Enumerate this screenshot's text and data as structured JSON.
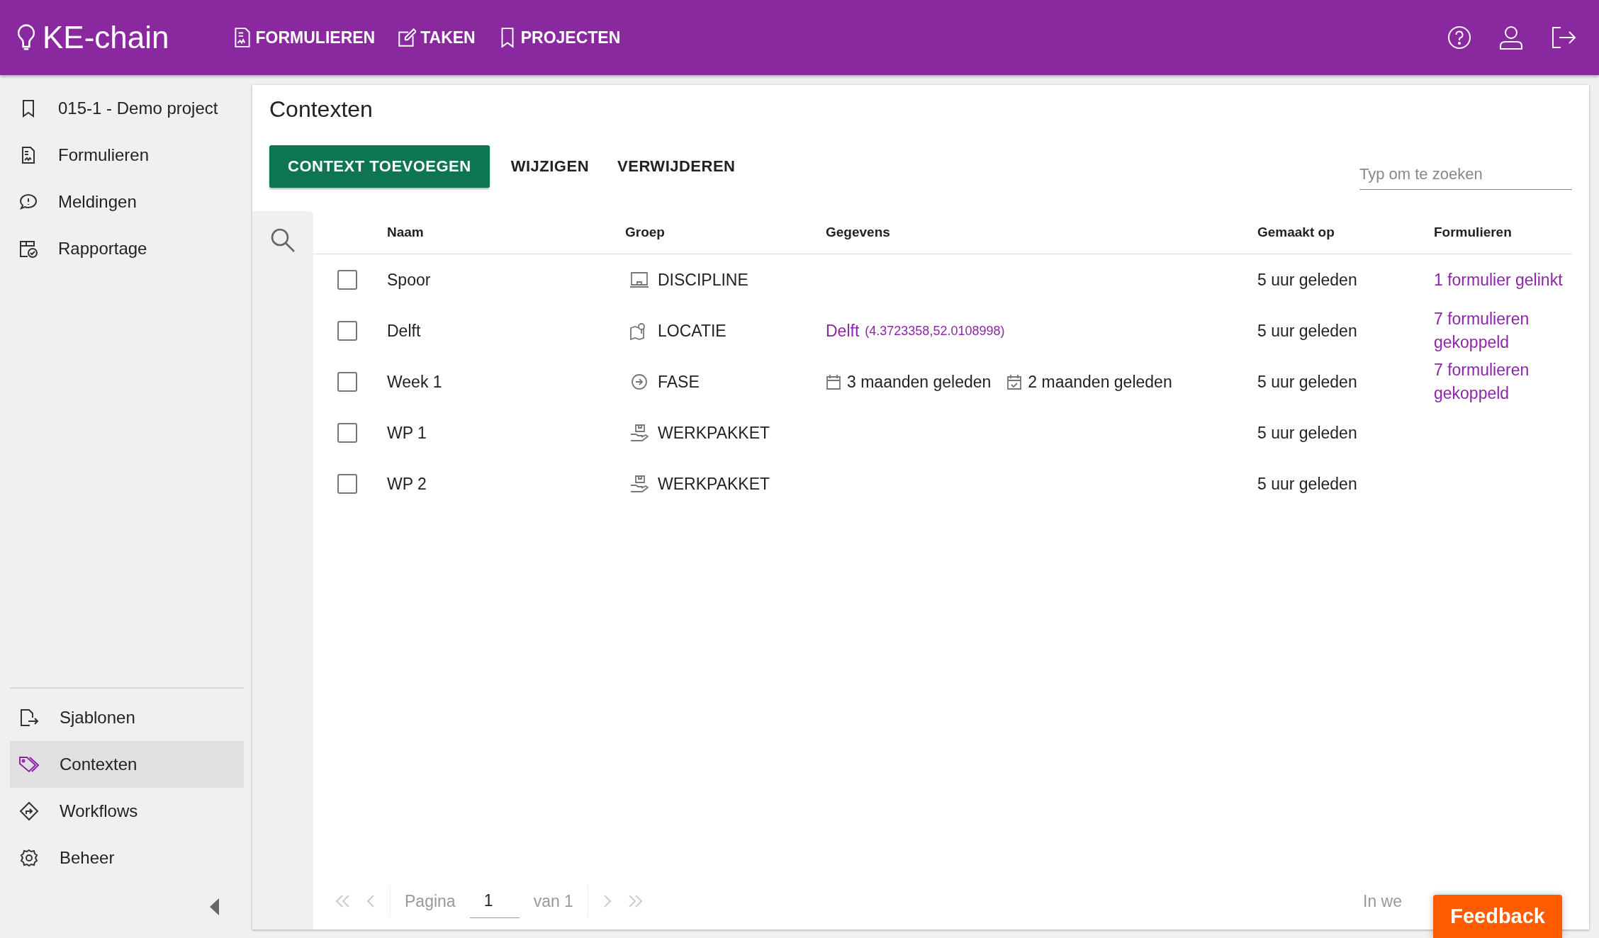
{
  "app": {
    "logo": "KE-chain"
  },
  "top_nav": [
    {
      "label": "FORMULIEREN"
    },
    {
      "label": "TAKEN"
    },
    {
      "label": "PROJECTEN"
    }
  ],
  "sidebar": {
    "top_items": [
      {
        "label": "015-1 - Demo project",
        "selected": false
      },
      {
        "label": "Formulieren",
        "selected": false
      },
      {
        "label": "Meldingen",
        "selected": false
      },
      {
        "label": "Rapportage",
        "selected": false
      }
    ],
    "bottom_items": [
      {
        "label": "Sjablonen",
        "selected": false
      },
      {
        "label": "Contexten",
        "selected": true
      },
      {
        "label": "Workflows",
        "selected": false
      },
      {
        "label": "Beheer",
        "selected": false
      }
    ]
  },
  "page": {
    "title": "Contexten",
    "actions": [
      {
        "label": "CONTEXT TOEVOEGEN",
        "kind": "primary"
      },
      {
        "label": "WIJZIGEN",
        "kind": "text"
      },
      {
        "label": "VERWIJDEREN",
        "kind": "text"
      }
    ],
    "search": {
      "placeholder": "Typ om te zoeken"
    }
  },
  "table": {
    "columns": [
      "Naam",
      "Groep",
      "Gegevens",
      "Gemaakt op",
      "Formulieren"
    ],
    "rows": [
      {
        "checked": false,
        "name": "Spoor",
        "group": "DISCIPLINE",
        "created": "5 uur geleden",
        "forms": "1 formulier gelinkt"
      },
      {
        "checked": false,
        "name": "Delft",
        "group": "LOCATIE",
        "data": {
          "kind": "location",
          "place": "Delft",
          "coords": "(4.3723358,52.0108998)"
        },
        "created": "5 uur geleden",
        "forms": "7 formulieren gekoppeld"
      },
      {
        "checked": false,
        "name": "Week 1",
        "group": "FASE",
        "data": {
          "kind": "dates",
          "start": "3 maanden geleden",
          "end": "2 maanden geleden"
        },
        "created": "5 uur geleden",
        "forms": "7 formulieren gekoppeld"
      },
      {
        "checked": false,
        "name": "WP 1",
        "group": "WERKPAKKET",
        "created": "5 uur geleden"
      },
      {
        "checked": false,
        "name": "WP 2",
        "group": "WERKPAKKET",
        "created": "5 uur geleden"
      }
    ]
  },
  "pagination": {
    "label": "Pagina",
    "page": "1",
    "of": "van 1",
    "trailing": "In we"
  },
  "feedback_button": "Feedback"
}
